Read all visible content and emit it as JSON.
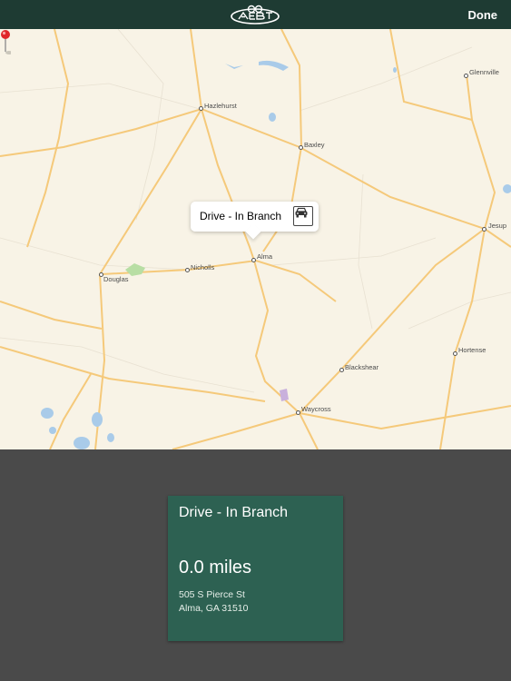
{
  "nav": {
    "done_label": "Done"
  },
  "map": {
    "cities": [
      {
        "name": "Glennville"
      },
      {
        "name": "Hazlehurst"
      },
      {
        "name": "Baxley"
      },
      {
        "name": "Jesup"
      },
      {
        "name": "Douglas"
      },
      {
        "name": "Nicholls"
      },
      {
        "name": "Alma"
      },
      {
        "name": "Hortense"
      },
      {
        "name": "Blackshear"
      },
      {
        "name": "Waycross"
      }
    ],
    "callout": {
      "title": "Drive - In Branch"
    }
  },
  "card": {
    "title": "Drive - In Branch",
    "distance": "0.0 miles",
    "address_line1": "505 S Pierce St",
    "address_line2": "Alma, GA 31510"
  },
  "colors": {
    "nav_bg": "#1e3b33",
    "card_bg": "#2d6152",
    "panel_bg": "#4a4a4a",
    "road": "#f5c97a"
  }
}
